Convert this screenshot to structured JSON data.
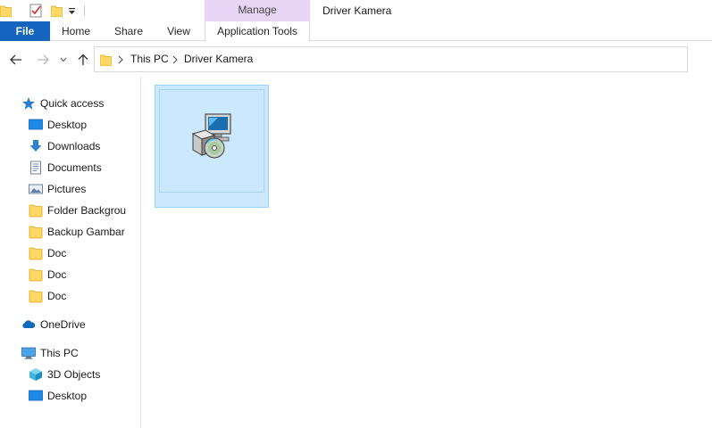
{
  "window": {
    "title": "Driver Kamera",
    "context_group": "Manage"
  },
  "ribbon": {
    "tabs": {
      "file": "File",
      "home": "Home",
      "share": "Share",
      "view": "View",
      "app_tools": "Application Tools"
    }
  },
  "address": {
    "crumbs": [
      "This PC",
      "Driver Kamera"
    ]
  },
  "navpane": {
    "quick_access": "Quick access",
    "items": [
      {
        "label": "Desktop",
        "icon": "desktop-icon",
        "pinned": true
      },
      {
        "label": "Downloads",
        "icon": "downloads-icon",
        "pinned": true
      },
      {
        "label": "Documents",
        "icon": "documents-icon",
        "pinned": true
      },
      {
        "label": "Pictures",
        "icon": "pictures-icon",
        "pinned": true
      },
      {
        "label": "Folder Backgrou",
        "icon": "folder-icon",
        "pinned": true
      },
      {
        "label": "Backup Gambar",
        "icon": "folder-icon",
        "pinned": false
      },
      {
        "label": "Doc",
        "icon": "folder-icon",
        "pinned": false
      },
      {
        "label": "Doc",
        "icon": "folder-icon",
        "pinned": false
      },
      {
        "label": "Doc",
        "icon": "folder-icon",
        "pinned": false
      }
    ],
    "onedrive": "OneDrive",
    "this_pc": "This PC",
    "pc_items": [
      {
        "label": "3D Objects",
        "icon": "3d-objects-icon"
      },
      {
        "label": "Desktop",
        "icon": "desktop-icon"
      }
    ]
  },
  "content": {
    "files": [
      {
        "name": "",
        "icon": "setup-installer-icon",
        "selected": true
      }
    ]
  },
  "colors": {
    "file_tab": "#1565c0",
    "context_group": "#e8d5f6",
    "selection_fill": "#cce8ff",
    "selection_border": "#99d1ff",
    "folder_yellow": "#ffd866"
  }
}
